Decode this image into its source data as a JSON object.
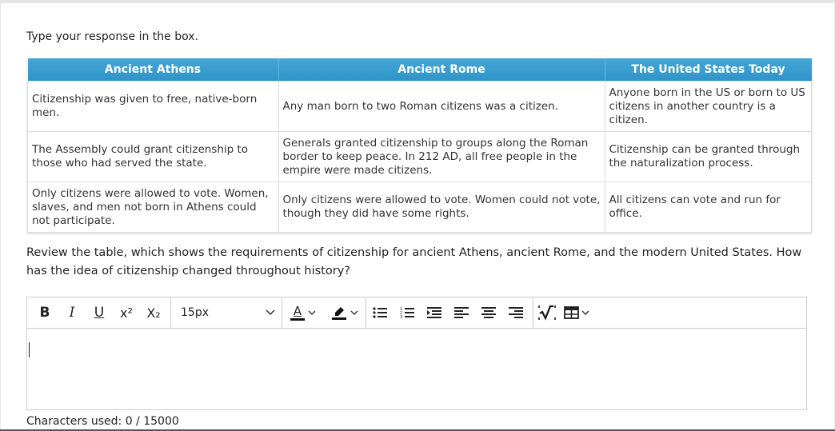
{
  "prompt": "Type your response in the box.",
  "table": {
    "headers": [
      "Ancient Athens",
      "Ancient Rome",
      "The United States Today"
    ],
    "rows": [
      [
        "Citizenship was given to free, native-born men.",
        "Any man born to two Roman citizens was a citizen.",
        "Anyone born in the US or born to US citizens in another country is a citizen."
      ],
      [
        "The Assembly could grant citizenship to those who had served the state.",
        "Generals granted citizenship to groups along the Roman border to keep peace. In 212 AD, all free people in the empire were made citizens.",
        "Citizenship can be granted through the naturalization process."
      ],
      [
        "Only citizens were allowed to vote. Women, slaves, and men not born in Athens could not participate.",
        "Only citizens were allowed to vote. Women could not vote, though they did have some rights.",
        "All citizens can vote and run for office."
      ]
    ]
  },
  "question": "Review the table, which shows the requirements of citizenship for ancient Athens, ancient Rome, and the modern United States. How has the idea of citizenship changed throughout history?",
  "editor": {
    "toolbar": {
      "bold": "B",
      "italic": "I",
      "underline": "U",
      "superscript": "x²",
      "subscript": "X₂",
      "font_size": "15px",
      "font_color_letter": "A",
      "icons": {
        "font_color": "font-color-icon",
        "highlight": "highlight-icon",
        "bullet_list": "bullet-list-icon",
        "numbered_list": "numbered-list-icon",
        "indent": "indent-icon",
        "align_left": "align-left-icon",
        "align_center": "align-center-icon",
        "align_right": "align-right-icon",
        "math": "math-icon",
        "table": "table-icon"
      }
    },
    "content": ""
  },
  "counter": "Characters used: 0 / 15000",
  "colors": {
    "header_bg": "#3a9fd2",
    "header_text": "#ffffff",
    "border": "#cccccc"
  }
}
